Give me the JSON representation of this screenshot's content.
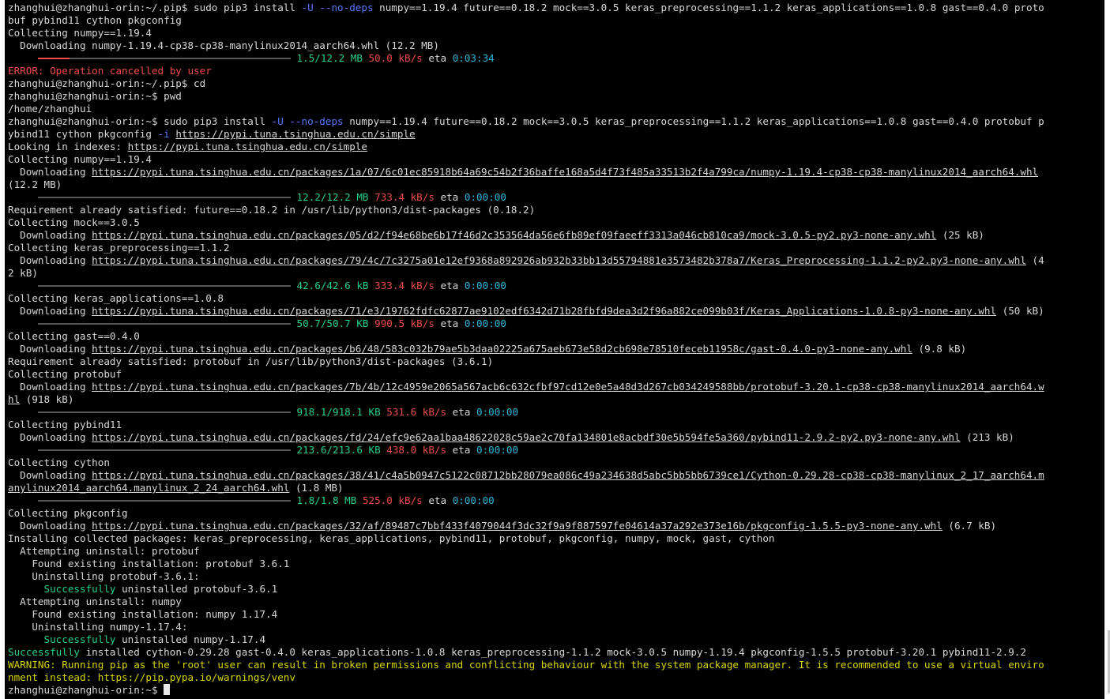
{
  "terminal": {
    "lines": [
      [
        {
          "t": "zhanghui@zhanghui-orin:~/.pip$ sudo pip3 install "
        },
        {
          "t": "-U",
          "s": "blue"
        },
        {
          "t": " "
        },
        {
          "t": "--no-deps",
          "s": "blue"
        },
        {
          "t": " numpy==1.19.4 future==0.18.2 mock==3.0.5 keras_preprocessing==1.1.2 keras_applications==1.0.8 gast==0.4.0 proto"
        }
      ],
      [
        {
          "t": "buf pybind11 cython pkgconfig"
        }
      ],
      [
        {
          "t": "Collecting numpy==1.19.4"
        }
      ],
      [
        {
          "t": "  Downloading numpy-1.19.4-cp38-cp38-manylinux2014_aarch64.whl (12.2 MB)"
        }
      ],
      [
        {
          "t": "     "
        },
        {
          "bar": [
            0.125,
            0.875
          ],
          "red": true
        },
        {
          "t": " "
        },
        {
          "t": "1.5/12.2 MB",
          "s": "green"
        },
        {
          "t": " "
        },
        {
          "t": "50.0 kB/s",
          "s": "red"
        },
        {
          "t": " eta "
        },
        {
          "t": "0:03:34",
          "s": "cyan"
        }
      ],
      [
        {
          "t": "ERROR: Operation cancelled by user",
          "s": "red"
        }
      ],
      [
        {
          "t": "zhanghui@zhanghui-orin:~/.pip$ cd"
        }
      ],
      [
        {
          "t": "zhanghui@zhanghui-orin:~$ pwd"
        }
      ],
      [
        {
          "t": "/home/zhanghui"
        }
      ],
      [
        {
          "t": "zhanghui@zhanghui-orin:~$ sudo pip3 install "
        },
        {
          "t": "-U",
          "s": "blue"
        },
        {
          "t": " "
        },
        {
          "t": "--no-deps",
          "s": "blue"
        },
        {
          "t": " numpy==1.19.4 future==0.18.2 mock==3.0.5 keras_preprocessing==1.1.2 keras_applications==1.0.8 gast==0.4.0 protobuf p"
        }
      ],
      [
        {
          "t": "ybind11 cython pkgconfig "
        },
        {
          "t": "-i",
          "s": "blue"
        },
        {
          "t": " "
        },
        {
          "t": "https://pypi.tuna.tsinghua.edu.cn/simple",
          "s": "link"
        }
      ],
      [
        {
          "t": "Looking in indexes: "
        },
        {
          "t": "https://pypi.tuna.tsinghua.edu.cn/simple",
          "s": "link"
        }
      ],
      [
        {
          "t": "Collecting numpy==1.19.4"
        }
      ],
      [
        {
          "t": "  Downloading "
        },
        {
          "t": "https://pypi.tuna.tsinghua.edu.cn/packages/1a/07/6c01ec85918b64a69c54b2f36baffe168a5d4f73f485a33513b2f4a799ca/numpy-1.19.4-cp38-cp38-manylinux2014_aarch64.whl",
          "s": "link"
        }
      ],
      [
        {
          "t": "(12.2 MB)"
        }
      ],
      [
        {
          "t": "     "
        },
        {
          "bar": [
            1,
            0
          ]
        },
        {
          "t": " "
        },
        {
          "t": "12.2/12.2 MB",
          "s": "green"
        },
        {
          "t": " "
        },
        {
          "t": "733.4 kB/s",
          "s": "red"
        },
        {
          "t": " eta "
        },
        {
          "t": "0:00:00",
          "s": "cyan"
        }
      ],
      [
        {
          "t": "Requirement already satisfied: future==0.18.2 in /usr/lib/python3/dist-packages (0.18.2)"
        }
      ],
      [
        {
          "t": "Collecting mock==3.0.5"
        }
      ],
      [
        {
          "t": "  Downloading "
        },
        {
          "t": "https://pypi.tuna.tsinghua.edu.cn/packages/05/d2/f94e68be6b17f46d2c353564da56e6fb89ef09faeeff3313a046cb810ca9/mock-3.0.5-py2.py3-none-any.whl",
          "s": "link"
        },
        {
          "t": " (25 kB)"
        }
      ],
      [
        {
          "t": "Collecting keras_preprocessing==1.1.2"
        }
      ],
      [
        {
          "t": "  Downloading "
        },
        {
          "t": "https://pypi.tuna.tsinghua.edu.cn/packages/79/4c/7c3275a01e12ef9368a892926ab932b33bb13d55794881e3573482b378a7/Keras_Preprocessing-1.1.2-py2.py3-none-any.whl",
          "s": "link"
        },
        {
          "t": " (4"
        }
      ],
      [
        {
          "t": "2 kB)"
        }
      ],
      [
        {
          "t": "     "
        },
        {
          "bar": [
            1,
            0
          ]
        },
        {
          "t": " "
        },
        {
          "t": "42.6/42.6 kB",
          "s": "green"
        },
        {
          "t": " "
        },
        {
          "t": "333.4 kB/s",
          "s": "red"
        },
        {
          "t": " eta "
        },
        {
          "t": "0:00:00",
          "s": "cyan"
        }
      ],
      [
        {
          "t": "Collecting keras_applications==1.0.8"
        }
      ],
      [
        {
          "t": "  Downloading "
        },
        {
          "t": "https://pypi.tuna.tsinghua.edu.cn/packages/71/e3/19762fdfc62877ae9102edf6342d71b28fbfd9dea3d2f96a882ce099b03f/Keras_Applications-1.0.8-py3-none-any.whl",
          "s": "link"
        },
        {
          "t": " (50 kB)"
        }
      ],
      [
        {
          "t": "     "
        },
        {
          "bar": [
            1,
            0
          ]
        },
        {
          "t": " "
        },
        {
          "t": "50.7/50.7 KB",
          "s": "green"
        },
        {
          "t": " "
        },
        {
          "t": "990.5 kB/s",
          "s": "red"
        },
        {
          "t": " eta "
        },
        {
          "t": "0:00:00",
          "s": "cyan"
        }
      ],
      [
        {
          "t": "Collecting gast==0.4.0"
        }
      ],
      [
        {
          "t": "  Downloading "
        },
        {
          "t": "https://pypi.tuna.tsinghua.edu.cn/packages/b6/48/583c032b79ae5b3daa02225a675aeb673e58d2cb698e78510feceb11958c/gast-0.4.0-py3-none-any.whl",
          "s": "link"
        },
        {
          "t": " (9.8 kB)"
        }
      ],
      [
        {
          "t": "Requirement already satisfied: protobuf in /usr/lib/python3/dist-packages (3.6.1)"
        }
      ],
      [
        {
          "t": "Collecting protobuf"
        }
      ],
      [
        {
          "t": "  Downloading "
        },
        {
          "t": "https://pypi.tuna.tsinghua.edu.cn/packages/7b/4b/12c4959e2065a567acb6c632cfbf97cd12e0e5a48d3d267cb034249588bb/protobuf-3.20.1-cp38-cp38-manylinux2014_aarch64.w",
          "s": "link"
        }
      ],
      [
        {
          "t": "hl",
          "s": "link"
        },
        {
          "t": " (918 kB)"
        }
      ],
      [
        {
          "t": "     "
        },
        {
          "bar": [
            1,
            0
          ]
        },
        {
          "t": " "
        },
        {
          "t": "918.1/918.1 KB",
          "s": "green"
        },
        {
          "t": " "
        },
        {
          "t": "531.6 kB/s",
          "s": "red"
        },
        {
          "t": " eta "
        },
        {
          "t": "0:00:00",
          "s": "cyan"
        }
      ],
      [
        {
          "t": "Collecting pybind11"
        }
      ],
      [
        {
          "t": "  Downloading "
        },
        {
          "t": "https://pypi.tuna.tsinghua.edu.cn/packages/fd/24/efc9e62aa1baa48622028c59ae2c70fa134801e8acbdf30e5b594fe5a360/pybind11-2.9.2-py2.py3-none-any.whl",
          "s": "link"
        },
        {
          "t": " (213 kB)"
        }
      ],
      [
        {
          "t": "     "
        },
        {
          "bar": [
            1,
            0
          ]
        },
        {
          "t": " "
        },
        {
          "t": "213.6/213.6 KB",
          "s": "green"
        },
        {
          "t": " "
        },
        {
          "t": "438.0 kB/s",
          "s": "red"
        },
        {
          "t": " eta "
        },
        {
          "t": "0:00:00",
          "s": "cyan"
        }
      ],
      [
        {
          "t": "Collecting cython"
        }
      ],
      [
        {
          "t": "  Downloading "
        },
        {
          "t": "https://pypi.tuna.tsinghua.edu.cn/packages/38/41/c4a5b0947c5122c08712bb28079ea086c49a234638d5abc5bb5bb6739ce1/Cython-0.29.28-cp38-cp38-manylinux_2_17_aarch64.m",
          "s": "link"
        }
      ],
      [
        {
          "t": "anylinux2014_aarch64.manylinux_2_24_aarch64.whl",
          "s": "link"
        },
        {
          "t": " (1.8 MB)"
        }
      ],
      [
        {
          "t": "     "
        },
        {
          "bar": [
            1,
            0
          ]
        },
        {
          "t": " "
        },
        {
          "t": "1.8/1.8 MB",
          "s": "green"
        },
        {
          "t": " "
        },
        {
          "t": "525.0 kB/s",
          "s": "red"
        },
        {
          "t": " eta "
        },
        {
          "t": "0:00:00",
          "s": "cyan"
        }
      ],
      [
        {
          "t": "Collecting pkgconfig"
        }
      ],
      [
        {
          "t": "  Downloading "
        },
        {
          "t": "https://pypi.tuna.tsinghua.edu.cn/packages/32/af/89487c7bbf433f4079044f3dc32f9a9f887597fe04614a37a292e373e16b/pkgconfig-1.5.5-py3-none-any.whl",
          "s": "link"
        },
        {
          "t": " (6.7 kB)"
        }
      ],
      [
        {
          "t": "Installing collected packages: keras_preprocessing, keras_applications, pybind11, protobuf, pkgconfig, numpy, mock, gast, cython"
        }
      ],
      [
        {
          "t": "  Attempting uninstall: protobuf"
        }
      ],
      [
        {
          "t": "    Found existing installation: protobuf 3.6.1"
        }
      ],
      [
        {
          "t": "    Uninstalling protobuf-3.6.1:"
        }
      ],
      [
        {
          "t": "      "
        },
        {
          "t": "Successfully",
          "s": "green"
        },
        {
          "t": " uninstalled protobuf-3.6.1"
        }
      ],
      [
        {
          "t": "  Attempting uninstall: numpy"
        }
      ],
      [
        {
          "t": "    Found existing installation: numpy 1.17.4"
        }
      ],
      [
        {
          "t": "    Uninstalling numpy-1.17.4:"
        }
      ],
      [
        {
          "t": "      "
        },
        {
          "t": "Successfully",
          "s": "green"
        },
        {
          "t": " uninstalled numpy-1.17.4"
        }
      ],
      [
        {
          "t": "Successfully",
          "s": "green"
        },
        {
          "t": " installed cython-0.29.28 gast-0.4.0 keras_applications-1.0.8 keras_preprocessing-1.1.2 mock-3.0.5 numpy-1.19.4 pkgconfig-1.5.5 protobuf-3.20.1 pybind11-2.9.2"
        }
      ],
      [
        {
          "t": "WARNING: Running pip as the 'root' user can result in broken permissions and conflicting behaviour with the system package manager. It is recommended to use a virtual enviro",
          "s": "yellow"
        }
      ],
      [
        {
          "t": "nment instead: https://pip.pypa.io/warnings/venv",
          "s": "yellow"
        }
      ],
      [
        {
          "t": "zhanghui@zhanghui-orin:~$ "
        },
        {
          "cursor": true
        }
      ]
    ]
  }
}
